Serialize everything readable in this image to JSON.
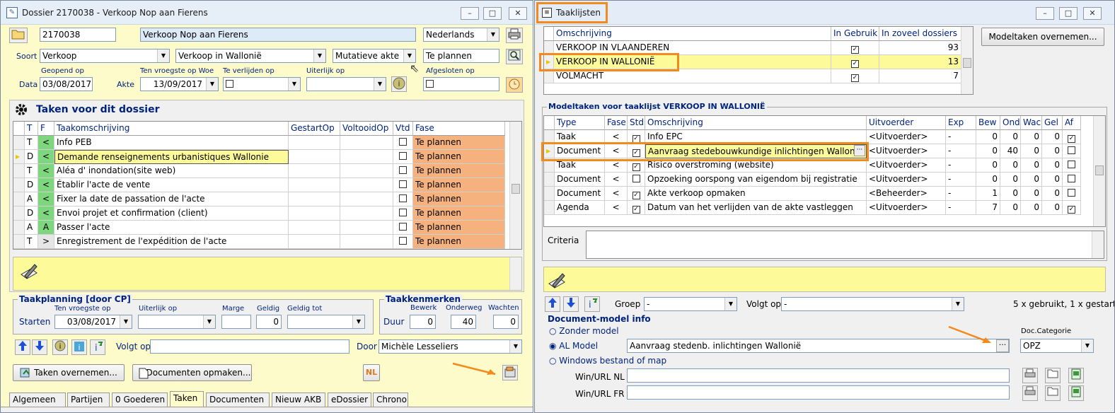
{
  "left": {
    "title": "Dossier 2170038 - Verkoop Nop aan Fierens",
    "dossier_nr": "2170038",
    "dossier_name": "Verkoop Nop aan Fierens",
    "language": "Nederlands",
    "soort_label": "Soort",
    "soort1": "Verkoop",
    "soort2": "Verkoop in Wallonië",
    "soort3": "Mutatieve akte",
    "status": "Te plannen",
    "data_label": "Data",
    "geopend_label": "Geopend op",
    "geopend": "03/08/2017",
    "akte_label": "Akte",
    "vroegste_label": "Ten vroegste op Woe",
    "vroegste": "13/09/2017",
    "verlijden_label": "Te verlijden op",
    "uiterlijk_label": "Uiterlijk op",
    "afgesloten_label": "Afgesloten op",
    "taken_title": "Taken voor dit dossier",
    "cols": [
      "T",
      "F",
      "Taakomschrijving",
      "GestartOp",
      "VoltooidOp",
      "Vtd",
      "Fase"
    ],
    "rows": [
      {
        "t": "T",
        "f": "<",
        "desc": "Info PEB",
        "fase": "Te plannen"
      },
      {
        "t": "D",
        "f": "<",
        "desc": "Demande renseignements urbanistiques Wallonie",
        "fase": "Te plannen"
      },
      {
        "t": "T",
        "f": "<",
        "desc": "Aléa d' inondation(site web)",
        "fase": "Te plannen"
      },
      {
        "t": "D",
        "f": "<",
        "desc": "Établir l'acte de vente",
        "fase": "Te plannen"
      },
      {
        "t": "A",
        "f": "<",
        "desc": "Fixer la date de passation de l'acte",
        "fase": "Te plannen"
      },
      {
        "t": "D",
        "f": "<",
        "desc": "Envoi projet et confirmation (client)",
        "fase": "Te plannen"
      },
      {
        "t": "A",
        "f": "A",
        "desc": "Passer l'acte",
        "fase": "Te plannen"
      },
      {
        "t": "T",
        "f": ">",
        "desc": "Enregistrement de l'expédition de l'acte",
        "fase": "Te plannen"
      }
    ],
    "planning_title": "Taakplanning  [door CP]",
    "starten_label": "Starten",
    "tv_label": "Ten vroegste op",
    "tv_value": "03/08/2017",
    "uo_label": "Uiterlijk op",
    "marge_label": "Marge",
    "geldig_label": "Geldig",
    "geldig_value": "0",
    "geldigtot_label": "Geldig tot",
    "kenmerken_title": "Taakkenmerken",
    "duur_label": "Duur",
    "bewerk_label": "Bewerk",
    "bewerk_value": "0",
    "onderweg_label": "Onderweg",
    "onderweg_value": "40",
    "wachten_label": "Wachten",
    "wachten_value": "0",
    "volgt_label": "Volgt op",
    "door_label": "Door",
    "door_value": "Michèle Lesseliers",
    "btn_taken": "Taken overnemen...",
    "btn_docs": "Documenten opmaken...",
    "nl_badge": "NL",
    "tabs": [
      "Algemeen",
      "Partijen",
      "0 Goederen",
      "Taken",
      "Documenten",
      "Nieuw AKB",
      "eDossier",
      "Chrono"
    ]
  },
  "right": {
    "title": "Taaklijsten",
    "btn_model": "Modeltaken overnemen...",
    "list_cols": [
      "Omschrijving",
      "In Gebruik",
      "In zoveel dossiers"
    ],
    "list_rows": [
      {
        "name": "VERKOOP IN VLAANDEREN",
        "count": "93"
      },
      {
        "name": "VERKOOP IN WALLONIË",
        "count": "13"
      },
      {
        "name": "VOLMACHT",
        "count": "7"
      }
    ],
    "model_title": "Modeltaken voor taaklijst VERKOOP IN WALLONIË",
    "model_cols": [
      "Type",
      "Fase",
      "Std",
      "Omschrijving",
      "Uitvoerder",
      "Exp",
      "Bew",
      "Ond",
      "Wac",
      "Gel",
      "Af"
    ],
    "model_rows": [
      {
        "type": "Taak",
        "fase": "<",
        "std": true,
        "desc": "Info EPC",
        "uitv": "<Uitvoerder>",
        "exp": "-",
        "bew": "0",
        "ond": "0",
        "wac": "0",
        "gel": "0",
        "af": true
      },
      {
        "type": "Document",
        "fase": "<",
        "std": true,
        "desc": "Aanvraag stedebouwkundige inlichtingen Wallonië",
        "uitv": "<Uitvoerder>",
        "exp": "-",
        "bew": "0",
        "ond": "40",
        "wac": "0",
        "gel": "0",
        "af": false
      },
      {
        "type": "Taak",
        "fase": "<",
        "std": true,
        "desc": "Risico overstroming (website)",
        "uitv": "<Uitvoerder>",
        "exp": "-",
        "bew": "0",
        "ond": "0",
        "wac": "0",
        "gel": "0",
        "af": false
      },
      {
        "type": "Document",
        "fase": "<",
        "std": false,
        "desc": "Opzoeking oorspong van eigendom bij registratie",
        "uitv": "<Uitvoerder>",
        "exp": "-",
        "bew": "0",
        "ond": "0",
        "wac": "0",
        "gel": "0",
        "af": false
      },
      {
        "type": "Document",
        "fase": "<",
        "std": true,
        "desc": "Akte verkoop opmaken",
        "uitv": "<Beheerder>",
        "exp": "-",
        "bew": "1",
        "ond": "0",
        "wac": "0",
        "gel": "0",
        "af": false
      },
      {
        "type": "Agenda",
        "fase": "<",
        "std": true,
        "desc": "Datum van het verlijden van de akte vastleggen",
        "uitv": "<Uitvoerder>",
        "exp": "-",
        "bew": "7",
        "ond": "0",
        "wac": "0",
        "gel": "0",
        "af": true
      }
    ],
    "criteria_label": "Criteria",
    "groep_label": "Groep",
    "groep_value": "-",
    "volgt_label": "Volgt op",
    "volgt_value": "-",
    "usage": "5 x gebruikt, 1 x gestart",
    "docinfo_title": "Document-model info",
    "opt_zonder": "Zonder model",
    "opt_al": "AL Model",
    "opt_windows": "Windows bestand of map",
    "al_value": "Aanvraag stedenb. inlichtingen Wallonië",
    "doccat_label": "Doc.Categorie",
    "doccat_value": "OPZ",
    "url_nl_label": "Win/URL NL",
    "url_fr_label": "Win/URL FR"
  },
  "colors": {
    "highlight": "#f28a1e",
    "selected_row": "#fdfb99",
    "fase": "#f6b27e",
    "yellow_bg": "#fdfbc9"
  }
}
